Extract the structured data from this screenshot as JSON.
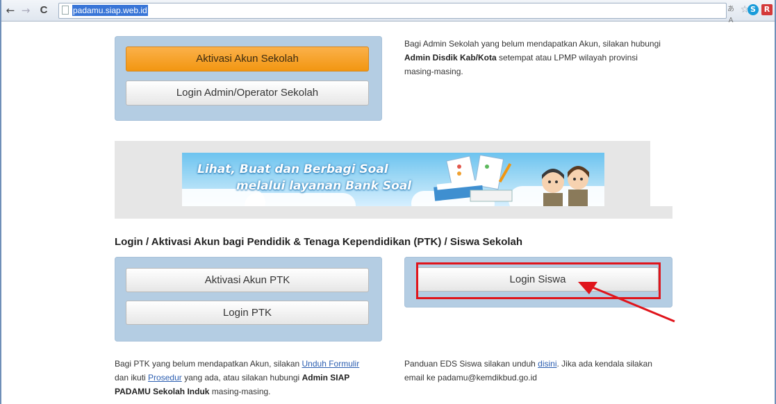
{
  "browser": {
    "url": "padamu.siap.web.id",
    "back_icon": "←",
    "forward_icon": "→",
    "reload_icon": "C",
    "translate_icon": "あA",
    "star_icon": "☆",
    "skype_icon": "S",
    "ext_icon": "R"
  },
  "top_section": {
    "activate_school_label": "Aktivasi Akun Sekolah",
    "login_admin_label": "Login Admin/Operator Sekolah",
    "info_text_1": "Bagi Admin Sekolah yang belum mendapatkan Akun, silakan hubungi",
    "info_bold": "Admin Disdik Kab/Kota",
    "info_text_2": "setempat atau LPMP wilayah provinsi masing-masing."
  },
  "banner": {
    "line1": "Lihat, Buat dan Berbagi Soal",
    "line2": "melalui layanan Bank Soal"
  },
  "ptk_section": {
    "heading": "Login / Aktivasi Akun bagi Pendidik & Tenaga Kependidikan (PTK) / Siswa Sekolah",
    "activate_ptk_label": "Aktivasi Akun PTK",
    "login_ptk_label": "Login PTK",
    "login_siswa_label": "Login Siswa",
    "ptk_info_1": "Bagi PTK yang belum mendapatkan Akun, silakan",
    "ptk_link_form": "Unduh Formulir",
    "ptk_info_2": "dan ikuti",
    "ptk_link_prosedur": "Prosedur",
    "ptk_info_3": "yang ada, atau silakan hubungi",
    "ptk_info_bold": "Admin SIAP PADAMU Sekolah Induk",
    "ptk_info_4": "masing-masing.",
    "siswa_info_1": "Panduan EDS Siswa silakan unduh",
    "siswa_link": "disini",
    "siswa_info_2": ". Jika ada kendala silakan email ke padamu@kemdikbud.go.id"
  },
  "colors": {
    "panel": "#b4cde3",
    "orange_button": "#f29611",
    "highlight": "#e0141b"
  }
}
